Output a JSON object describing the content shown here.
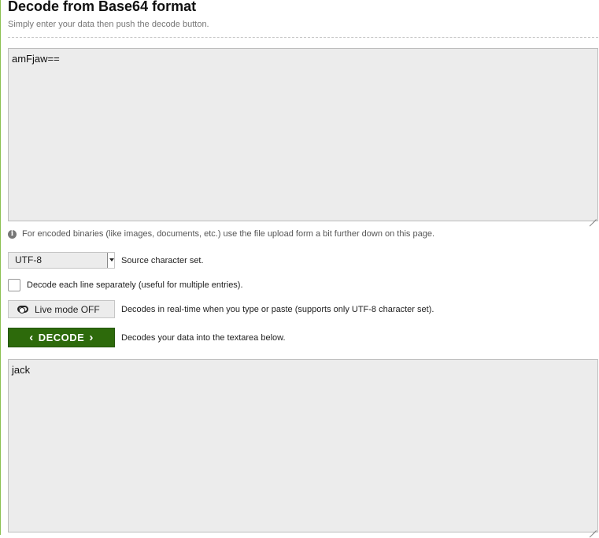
{
  "header": {
    "title": "Decode from Base64 format",
    "subtitle": "Simply enter your data then push the decode button."
  },
  "input": {
    "value": "amFjaw=="
  },
  "note": {
    "text": "For encoded binaries (like images, documents, etc.) use the file upload form a bit further down on this page."
  },
  "charset": {
    "selected": "UTF-8",
    "label": "Source character set."
  },
  "line_option": {
    "label": "Decode each line separately (useful for multiple entries).",
    "checked": false
  },
  "live_mode": {
    "button_label": "Live mode OFF",
    "description": "Decodes in real-time when you type or paste (supports only UTF-8 character set)."
  },
  "decode": {
    "button_label": "DECODE",
    "description": "Decodes your data into the textarea below."
  },
  "output": {
    "value": "jack"
  },
  "colors": {
    "decode_button": "#2d6a0b",
    "textarea_bg": "#ececec",
    "left_accent": "#8cc152"
  }
}
